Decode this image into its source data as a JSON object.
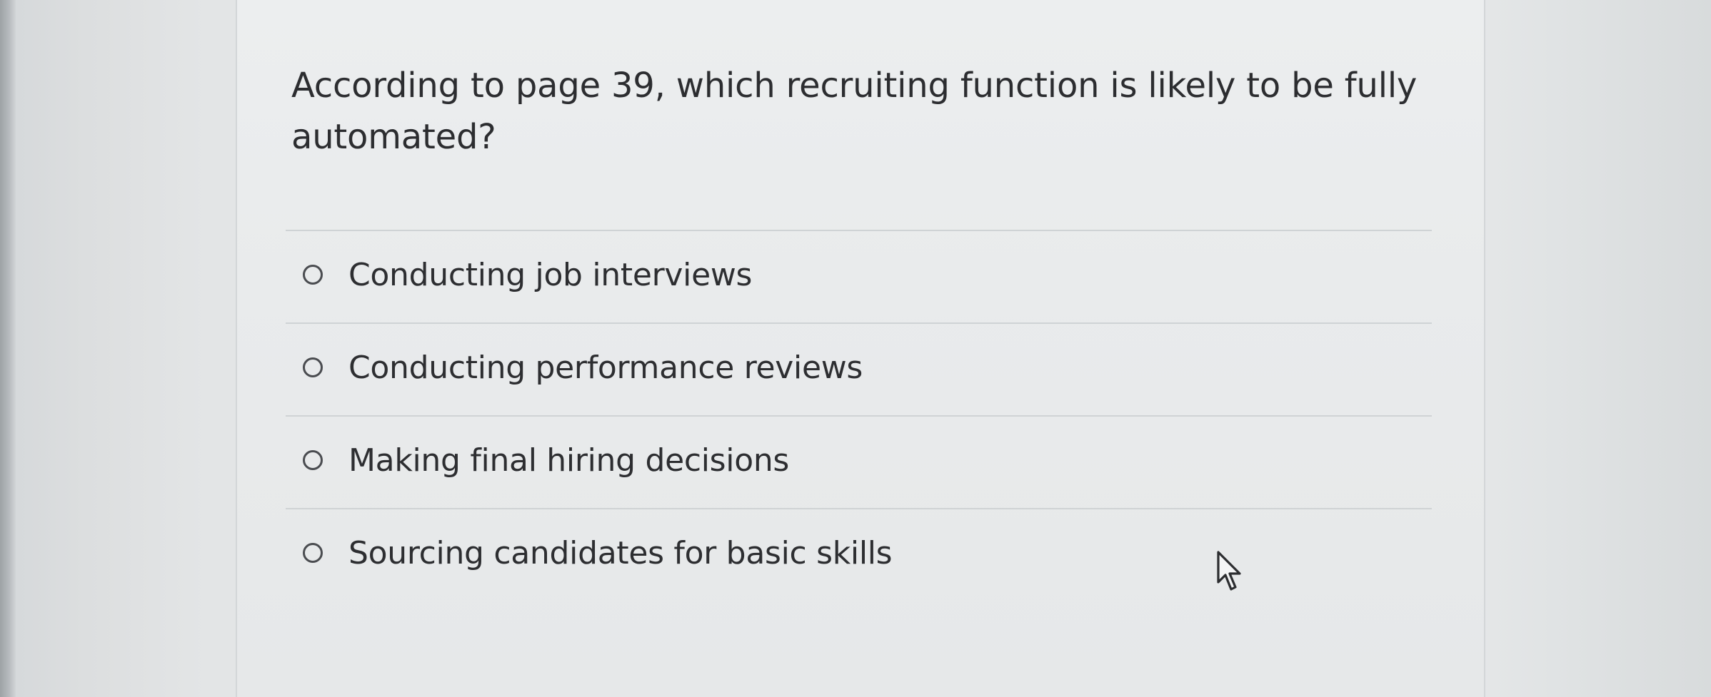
{
  "question": {
    "text": "According to page 39, which recruiting function is likely to be fully automated?"
  },
  "answers": [
    {
      "label": "Conducting job interviews",
      "selected": false
    },
    {
      "label": "Conducting performance reviews",
      "selected": false
    },
    {
      "label": "Making final hiring decisions",
      "selected": false
    },
    {
      "label": "Sourcing candidates for basic skills",
      "selected": false
    }
  ],
  "cursor": {
    "icon": "mouse-pointer-icon"
  }
}
